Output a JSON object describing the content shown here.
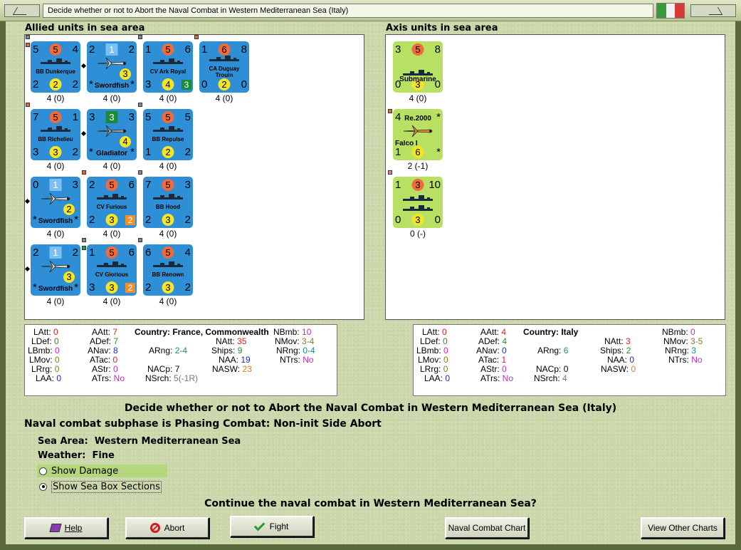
{
  "window": {
    "title": "Decide whether or not to Abort the Naval Combat in Western Mediterranean Sea (Italy)",
    "flag_colors": [
      "#3a9a3a",
      "#f2f2f2",
      "#d83a3a"
    ]
  },
  "allied": {
    "heading": "Allied units in sea area",
    "units": [
      {
        "name": "BB Dunkerque",
        "tl": "5",
        "tc": "5",
        "tr": "4",
        "bl": "2",
        "bc": "2",
        "br": "2",
        "strength": "4 (0)"
      },
      {
        "name": "Swordfish",
        "tl": "2",
        "tc": "1",
        "tr": "2",
        "bl": "*",
        "bc": "",
        "br": "*",
        "extra": "3",
        "strength": "4 (0)"
      },
      {
        "name": "CV Ark Royal",
        "tl": "1",
        "tc": "5",
        "tr": "6",
        "bl": "3",
        "bc": "4",
        "br": "",
        "extra": "3",
        "strength": "4 (0)"
      },
      {
        "name": "CA Duguay Trouin",
        "tl": "1",
        "tc": "6",
        "tr": "8",
        "bl": "0",
        "bc": "2",
        "br": "0",
        "strength": "4 (0)"
      },
      {
        "name": "BB Richelieu",
        "tl": "7",
        "tc": "5",
        "tr": "1",
        "bl": "3",
        "bc": "3",
        "br": "2",
        "strength": "4 (0)"
      },
      {
        "name": "Gladiator",
        "tl": "3",
        "tc": "3",
        "tr": "3",
        "bl": "*",
        "bc": "",
        "br": "*",
        "extra": "4",
        "strength": "4 (0)"
      },
      {
        "name": "BB Repulse",
        "tl": "5",
        "tc": "5",
        "tr": "5",
        "bl": "1",
        "bc": "2",
        "br": "2",
        "strength": "4 (0)"
      },
      {
        "name": "Swordfish",
        "tl": "0",
        "tc": "1",
        "tr": "3",
        "bl": "*",
        "bc": "",
        "br": "*",
        "extra": "2",
        "strength": "4 (0)"
      },
      {
        "name": "CV Furious",
        "tl": "2",
        "tc": "5",
        "tr": "6",
        "bl": "2",
        "bc": "3",
        "br": "",
        "extra": "2",
        "strength": "4 (0)"
      },
      {
        "name": "BB Hood",
        "tl": "7",
        "tc": "5",
        "tr": "3",
        "bl": "2",
        "bc": "3",
        "br": "2",
        "strength": "4 (0)"
      },
      {
        "name": "Swordfish",
        "tl": "2",
        "tc": "1",
        "tr": "2",
        "bl": "*",
        "bc": "",
        "br": "*",
        "extra": "3",
        "strength": "4 (0)"
      },
      {
        "name": "CV Glorious",
        "tl": "1",
        "tc": "5",
        "tr": "6",
        "bl": "3",
        "bc": "3",
        "br": "",
        "extra": "2",
        "strength": "4 (0)"
      },
      {
        "name": "BB Renown",
        "tl": "6",
        "tc": "5",
        "tr": "4",
        "bl": "2",
        "bc": "3",
        "br": "2",
        "strength": "4 (0)"
      }
    ],
    "stats": {
      "latt_k": "LAtt:",
      "latt": "0",
      "ldef_k": "LDef:",
      "ldef": "0",
      "lbmb_k": "LBmb:",
      "lbmb": "0",
      "lmov_k": "LMov:",
      "lmov": "0",
      "lrrg_k": "LRrg:",
      "lrrg": "0",
      "laa_k": "LAA:",
      "laa": "0",
      "aatt_k": "AAtt:",
      "aatt": "7",
      "adef_k": "ADef:",
      "adef": "7",
      "anav_k": "ANav:",
      "anav": "8",
      "atac_k": "ATac:",
      "atac": "0",
      "astr_k": "AStr:",
      "astr": "0",
      "atrs_k": "ATrs:",
      "atrs": "No",
      "country_k": "Country:",
      "country": "France, Commonwealth",
      "arng_k": "ARng:",
      "arng": "2-4",
      "nacp_k": "NACp:",
      "nacp": "7",
      "nsrch_k": "NSrch:",
      "nsrch": "5(-1R)",
      "natt_k": "NAtt:",
      "natt": "35",
      "ships_k": "Ships:",
      "ships": "9",
      "naa_k": "NAA:",
      "naa": "19",
      "nasw_k": "NASW:",
      "nasw": "23",
      "nbmb_k": "NBmb:",
      "nbmb": "10",
      "nmov_k": "NMov:",
      "nmov": "3-4",
      "nrng_k": "NRng:",
      "nrng": "0-4",
      "ntrs_k": "NTrs:",
      "ntrs": "No"
    }
  },
  "axis": {
    "heading": "Axis units in sea area",
    "units": [
      {
        "name": "Submarine",
        "tl": "3",
        "tc": "5",
        "tr": "8",
        "bl": "0",
        "bc": "3",
        "br": "0",
        "strength": "4 (0)"
      },
      {
        "name": "Re.2000",
        "name2": "Falco I",
        "tl": "4",
        "tc": "",
        "tr": "*",
        "bl": "1",
        "bc": "6",
        "br": "*",
        "strength": "2 (-1)"
      },
      {
        "name": "",
        "tl": "1",
        "tc": "3",
        "tr": "10",
        "bl": "0",
        "bc": "3",
        "br": "0",
        "strength": "0 (-)"
      }
    ],
    "stats": {
      "latt_k": "LAtt:",
      "latt": "0",
      "ldef_k": "LDef:",
      "ldef": "0",
      "lbmb_k": "LBmb:",
      "lbmb": "0",
      "lmov_k": "LMov:",
      "lmov": "0",
      "lrrg_k": "LRrg:",
      "lrrg": "0",
      "laa_k": "LAA:",
      "laa": "0",
      "aatt_k": "AAtt:",
      "aatt": "4",
      "adef_k": "ADef:",
      "adef": "4",
      "anav_k": "ANav:",
      "anav": "0",
      "atac_k": "ATac:",
      "atac": "1",
      "astr_k": "AStr:",
      "astr": "0",
      "atrs_k": "ATrs:",
      "atrs": "No",
      "country_k": "Country:",
      "country": "Italy",
      "arng_k": "ARng:",
      "arng": "6",
      "nacp_k": "NACp:",
      "nacp": "0",
      "nsrch_k": "NSrch:",
      "nsrch": "4",
      "natt_k": "NAtt:",
      "natt": "3",
      "ships_k": "Ships:",
      "ships": "2",
      "naa_k": "NAA:",
      "naa": "0",
      "nasw_k": "NASW:",
      "nasw": "0",
      "nbmb_k": "NBmb:",
      "nbmb": "0",
      "nmov_k": "NMov:",
      "nmov": "3-5",
      "nrng_k": "NRng:",
      "nrng": "3",
      "ntrs_k": "NTrs:",
      "ntrs": "No"
    }
  },
  "info": {
    "headline": "Decide whether or not to Abort the Naval Combat in Western Mediterranean Sea (Italy)",
    "subphase": "Naval combat subphase is Phasing Combat: Non-init Side Abort",
    "sea_area_label": "Sea Area:",
    "sea_area": "Western Mediterranean Sea",
    "weather_label": "Weather:",
    "weather": "Fine",
    "show_damage": "Show Damage",
    "show_sea_box": "Show Sea Box Sections",
    "question": "Continue the naval combat in Western Mediterranean Sea?"
  },
  "buttons": {
    "help": "Help",
    "abort": "Abort",
    "fight": "Fight",
    "naval_chart": "Naval Combat Chart",
    "other_charts": "View Other Charts"
  }
}
